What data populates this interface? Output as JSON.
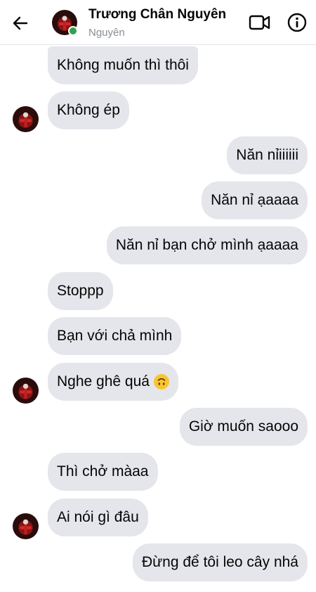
{
  "header": {
    "contact_name": "Trương Chân Nguyên",
    "contact_subtitle": "Nguyên",
    "online": true,
    "online_color": "#31a24c"
  },
  "messages": [
    {
      "side": "in",
      "text": "Không muốn thì thôi"
    },
    {
      "side": "in",
      "text": "Không ép"
    },
    {
      "side": "out",
      "text": "Năn nỉiiiiii"
    },
    {
      "side": "out",
      "text": "Năn nỉ ạaaaa"
    },
    {
      "side": "out",
      "text": "Năn nỉ bạn chở mình ạaaaa"
    },
    {
      "side": "in",
      "text": "Stoppp"
    },
    {
      "side": "in",
      "text": "Bạn với chả mình"
    },
    {
      "side": "in",
      "text": "Nghe ghê quá",
      "emoji": "upside-down-face"
    },
    {
      "side": "out",
      "text": "Giờ muốn saooo"
    },
    {
      "side": "in",
      "text": "Thì chở màaa"
    },
    {
      "side": "in",
      "text": "Ai nói gì đâu"
    },
    {
      "side": "out",
      "text": "Đừng để tôi leo cây nhá"
    }
  ],
  "colors": {
    "bubble": "#e4e6eb",
    "text": "#050505",
    "subtitle": "#8a8d91",
    "emoji": "#f7c531"
  }
}
